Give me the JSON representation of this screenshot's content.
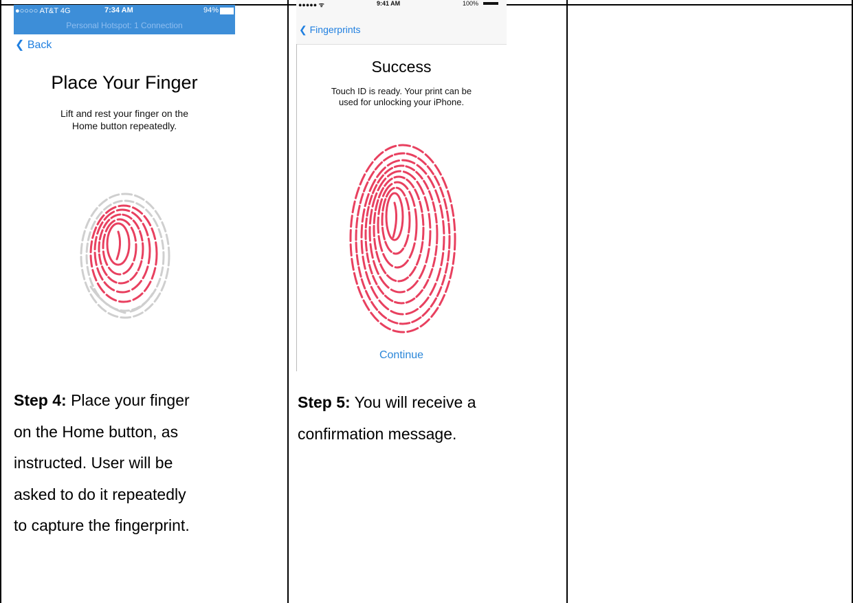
{
  "phone1": {
    "carrier": "●○○○○ AT&T  4G",
    "time": "7:34 AM",
    "battery": "94%",
    "hotspot": "Personal Hotspot: 1 Connection",
    "back": "Back",
    "title": "Place Your Finger",
    "subtitle_line1": "Lift and rest your finger on the",
    "subtitle_line2": "Home button repeatedly."
  },
  "phone2": {
    "signal": "●●●●● ᯤ",
    "time": "9:41 AM",
    "battery": "100%",
    "back": "Fingerprints",
    "title": "Success",
    "subtitle_line1": "Touch ID is ready. Your print can be",
    "subtitle_line2": "used for unlocking your iPhone.",
    "continue": "Continue"
  },
  "step4": {
    "label": "Step 4:",
    "line1": " Place your finger",
    "line2": "on the Home button, as",
    "line3": "instructed. User will be",
    "line4": "asked to do it repeatedly",
    "line5": "to capture the fingerprint."
  },
  "step5": {
    "label": "Step 5:",
    "line1": " You will receive a",
    "line2": "confirmation message."
  }
}
